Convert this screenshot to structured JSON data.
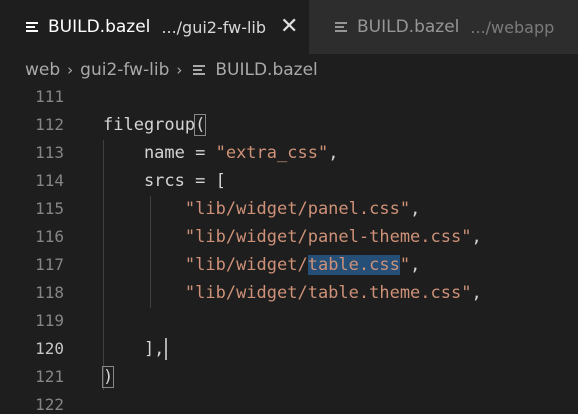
{
  "tabs": [
    {
      "title": "BUILD.bazel",
      "description": ".../gui2-fw-lib",
      "active": true,
      "close_glyph": "✕"
    },
    {
      "title": "BUILD.bazel",
      "description": ".../webapp",
      "active": false
    }
  ],
  "breadcrumb": {
    "items": [
      "web",
      "gui2-fw-lib",
      "BUILD.bazel"
    ],
    "separator": "›"
  },
  "editor": {
    "lines": [
      {
        "num": "111",
        "text": ""
      },
      {
        "num": "112",
        "text": "filegroup("
      },
      {
        "num": "113",
        "text": "    name = \"extra_css\","
      },
      {
        "num": "114",
        "text": "    srcs = ["
      },
      {
        "num": "115",
        "text": "        \"lib/widget/panel.css\","
      },
      {
        "num": "116",
        "text": "        \"lib/widget/panel-theme.css\","
      },
      {
        "num": "117",
        "text": "        \"lib/widget/table.css\","
      },
      {
        "num": "118",
        "text": "        \"lib/widget/table.theme.css\","
      },
      {
        "num": "119",
        "text": ""
      },
      {
        "num": "120",
        "text": "    ],"
      },
      {
        "num": "121",
        "text": ")"
      },
      {
        "num": "122",
        "text": ""
      }
    ],
    "current_line": "120",
    "selection_text": "table.css",
    "colors": {
      "background": "#1e1e1e",
      "string": "#ce9178",
      "selection": "#264f78",
      "line_number": "#858585"
    }
  },
  "icons": {
    "file": "file-lines-icon",
    "close": "close-icon",
    "chevron": "chevron-right-icon"
  }
}
